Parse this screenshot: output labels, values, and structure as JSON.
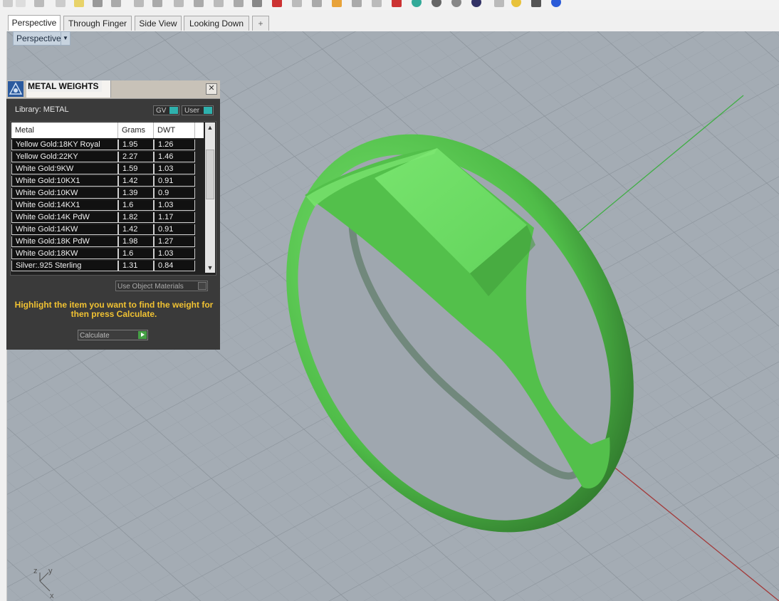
{
  "viewport_tabs": [
    {
      "label": "Perspective"
    },
    {
      "label": "Through Finger"
    },
    {
      "label": "Side View"
    },
    {
      "label": "Looking Down"
    },
    {
      "label": "+"
    }
  ],
  "viewport": {
    "label": "Perspective",
    "dropdown_icon": "chevron-down-icon",
    "axis_labels": {
      "z": "z",
      "y": "y",
      "x": "x"
    }
  },
  "panel": {
    "title": "METAL WEIGHTS",
    "library_label": "Library: METAL",
    "toggle_gv": "GV",
    "toggle_user": "User",
    "columns": [
      "Metal",
      "Grams",
      "DWT"
    ],
    "rows": [
      {
        "metal": "Yellow Gold:18KY Royal",
        "grams": "1.95",
        "dwt": "1.26"
      },
      {
        "metal": "Yellow Gold:22KY",
        "grams": "2.27",
        "dwt": "1.46"
      },
      {
        "metal": "White Gold:9KW",
        "grams": "1.59",
        "dwt": "1.03"
      },
      {
        "metal": "White Gold:10KX1",
        "grams": "1.42",
        "dwt": "0.91"
      },
      {
        "metal": "White Gold:10KW",
        "grams": "1.39",
        "dwt": "0.9"
      },
      {
        "metal": "White Gold:14KX1",
        "grams": "1.6",
        "dwt": "1.03"
      },
      {
        "metal": "White Gold:14K PdW",
        "grams": "1.82",
        "dwt": "1.17"
      },
      {
        "metal": "White Gold:14KW",
        "grams": "1.42",
        "dwt": "0.91"
      },
      {
        "metal": "White Gold:18K PdW",
        "grams": "1.98",
        "dwt": "1.27"
      },
      {
        "metal": "White Gold:18KW",
        "grams": "1.6",
        "dwt": "1.03"
      },
      {
        "metal": "Silver:.925 Sterling",
        "grams": "1.31",
        "dwt": "0.84"
      }
    ],
    "use_object_materials": "Use Object Materials",
    "hint": "Highlight the item you want to find the weight for then press Calculate.",
    "calculate_label": "Calculate"
  },
  "colors": {
    "viewport_bg": "#a4acb4",
    "ring_green": "#5ed65a",
    "hint_text": "#f1c232",
    "toggle_accent": "#2fb1ad"
  }
}
